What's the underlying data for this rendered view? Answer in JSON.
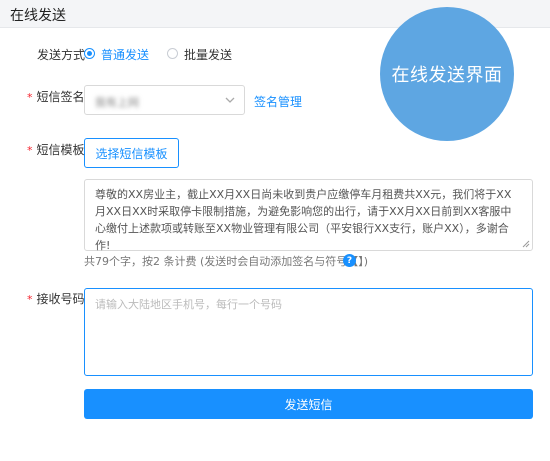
{
  "header": {
    "title": "在线发送"
  },
  "badge": {
    "text": "在线发送界面"
  },
  "send_mode": {
    "label": "发送方式",
    "options": [
      {
        "label": "普通发送",
        "checked": true
      },
      {
        "label": "批量发送",
        "checked": false
      }
    ]
  },
  "signature": {
    "label": "短信签名",
    "value": "我有上网",
    "manage_link": "签名管理"
  },
  "template": {
    "label": "短信模板",
    "select_button": "选择短信模板",
    "content": "尊敬的XX房业主，截止XX月XX日尚未收到贵户应缴停车月租费共XX元，我们将于XX月XX日XX时采取停卡限制措施，为避免影响您的出行，请于XX月XX日前到XX客服中心缴付上述款项或转账至XX物业管理有限公司（平安银行XX支行，账户XX），多谢合作!",
    "hint": "共79个字，按2 条计费 (发送时会自动添加签名与符号【】)"
  },
  "receiver": {
    "label": "接收号码",
    "placeholder": "请输入大陆地区手机号，每行一个号码"
  },
  "submit": {
    "label": "发送短信"
  },
  "colors": {
    "primary": "#1890ff",
    "badge": "#5ea6e2",
    "required": "#f5222d"
  }
}
